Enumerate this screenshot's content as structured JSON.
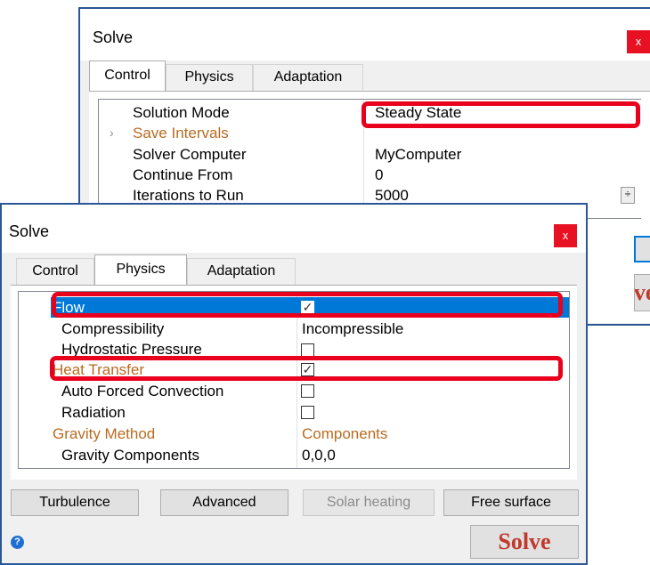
{
  "back_window": {
    "title": "Solve",
    "close_label": "x",
    "tabs": [
      {
        "label": "Control"
      },
      {
        "label": "Physics"
      },
      {
        "label": "Adaptation"
      }
    ],
    "expander": "›",
    "properties": [
      {
        "name": "Solution Mode",
        "value": "Steady State"
      },
      {
        "name": "Save Intervals",
        "value": ""
      },
      {
        "name": "Solver Computer",
        "value": "MyComputer"
      },
      {
        "name": "Continue From",
        "value": "0"
      },
      {
        "name": "Iterations to Run",
        "value": "5000"
      }
    ],
    "spinner_symbol": "÷",
    "solve_partial": "lve"
  },
  "front_window": {
    "title": "Solve",
    "close_label": "x",
    "tabs": [
      {
        "label": "Control"
      },
      {
        "label": "Physics"
      },
      {
        "label": "Adaptation"
      }
    ],
    "properties": [
      {
        "name": "Flow",
        "checked": true
      },
      {
        "name": "Compressibility",
        "value": "Incompressible"
      },
      {
        "name": "Hydrostatic Pressure",
        "checked": false
      },
      {
        "name": "Heat Transfer",
        "checked": true
      },
      {
        "name": "Auto Forced Convection",
        "checked": false
      },
      {
        "name": "Radiation",
        "checked": false
      },
      {
        "name": "Gravity Method",
        "value": "Components"
      },
      {
        "name": "Gravity Components",
        "value": "0,0,0"
      }
    ],
    "buttons": [
      {
        "label": "Turbulence"
      },
      {
        "label": "Advanced"
      },
      {
        "label": "Solar heating"
      },
      {
        "label": "Free surface"
      }
    ],
    "help_symbol": "?",
    "solve_label": "Solve"
  },
  "colors": {
    "highlight_red": "#e8001c",
    "selection_blue": "#0078d7",
    "category_orange": "#b86b20",
    "solve_text": "#c0392b",
    "window_border": "#2b5797"
  }
}
